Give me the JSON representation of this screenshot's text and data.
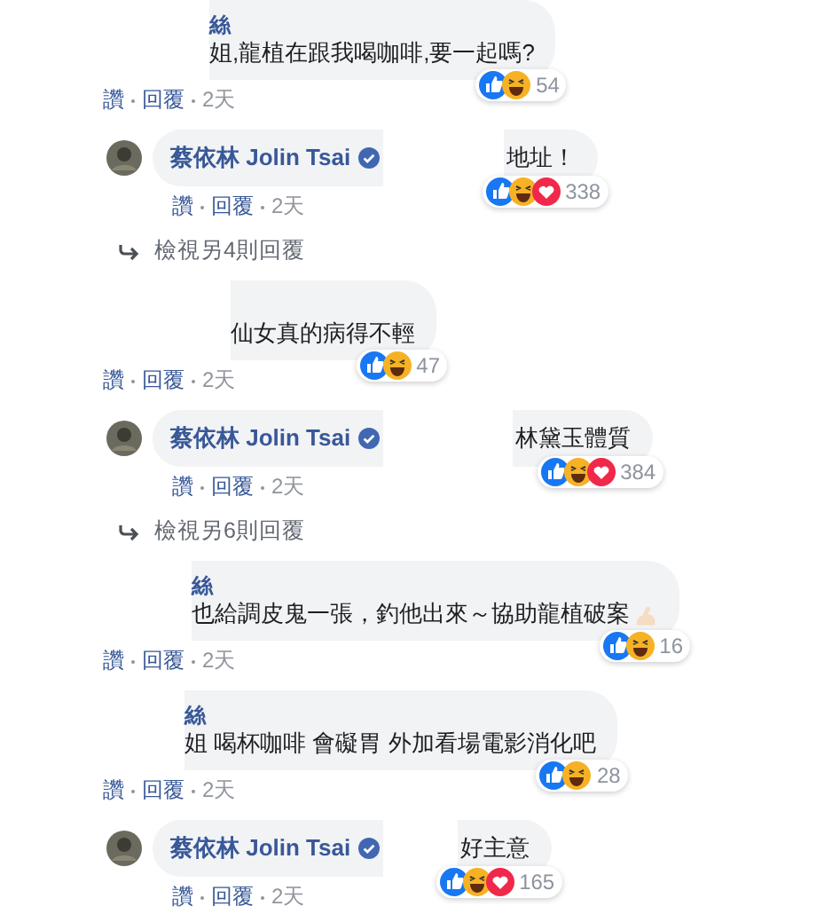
{
  "thread": [
    {
      "kind": "comment",
      "author": "絲",
      "text": "姐,龍植在跟我喝咖啡,要一起嗎?",
      "reactions": [
        {
          "kind": "like"
        },
        {
          "kind": "haha"
        }
      ],
      "count": "54",
      "actions": [
        "讚",
        "回覆"
      ],
      "time": "2天"
    },
    {
      "kind": "reply",
      "author": "蔡依林 Jolin Tsai",
      "verified": true,
      "text": "地址！",
      "reactions": [
        {
          "kind": "like"
        },
        {
          "kind": "haha"
        },
        {
          "kind": "love"
        }
      ],
      "count": "338",
      "actions": [
        "讚",
        "回覆"
      ],
      "time": "2天"
    },
    {
      "kind": "more",
      "text": "檢視另4則回覆"
    },
    {
      "kind": "comment",
      "text": "仙女真的病得不輕",
      "reactions": [
        {
          "kind": "like"
        },
        {
          "kind": "haha"
        }
      ],
      "count": "47",
      "actions": [
        "讚",
        "回覆"
      ],
      "time": "2天"
    },
    {
      "kind": "reply",
      "author": "蔡依林 Jolin Tsai",
      "verified": true,
      "text": "林黛玉體質",
      "reactions": [
        {
          "kind": "like"
        },
        {
          "kind": "haha"
        },
        {
          "kind": "love"
        }
      ],
      "count": "384",
      "actions": [
        "讚",
        "回覆"
      ],
      "time": "2天"
    },
    {
      "kind": "more",
      "text": "檢視另6則回覆"
    },
    {
      "kind": "comment",
      "author": "絲",
      "text": "也給調皮鬼一張，釣他出來～協助龍植破案",
      "emoji": true,
      "reactions": [
        {
          "kind": "like"
        },
        {
          "kind": "haha"
        }
      ],
      "count": "16",
      "actions": [
        "讚",
        "回覆"
      ],
      "time": "2天"
    },
    {
      "kind": "comment",
      "author": "絲",
      "text": "姐 喝杯咖啡 會礙胃 外加看場電影消化吧",
      "reactions": [
        {
          "kind": "like"
        },
        {
          "kind": "haha"
        }
      ],
      "count": "28",
      "actions": [
        "讚",
        "回覆"
      ],
      "time": "2天"
    },
    {
      "kind": "reply",
      "author": "蔡依林 Jolin Tsai",
      "verified": true,
      "text": "好主意",
      "reactions": [
        {
          "kind": "like"
        },
        {
          "kind": "haha"
        },
        {
          "kind": "love"
        }
      ],
      "count": "165",
      "actions": [
        "讚",
        "回覆"
      ],
      "time": "2天"
    }
  ]
}
